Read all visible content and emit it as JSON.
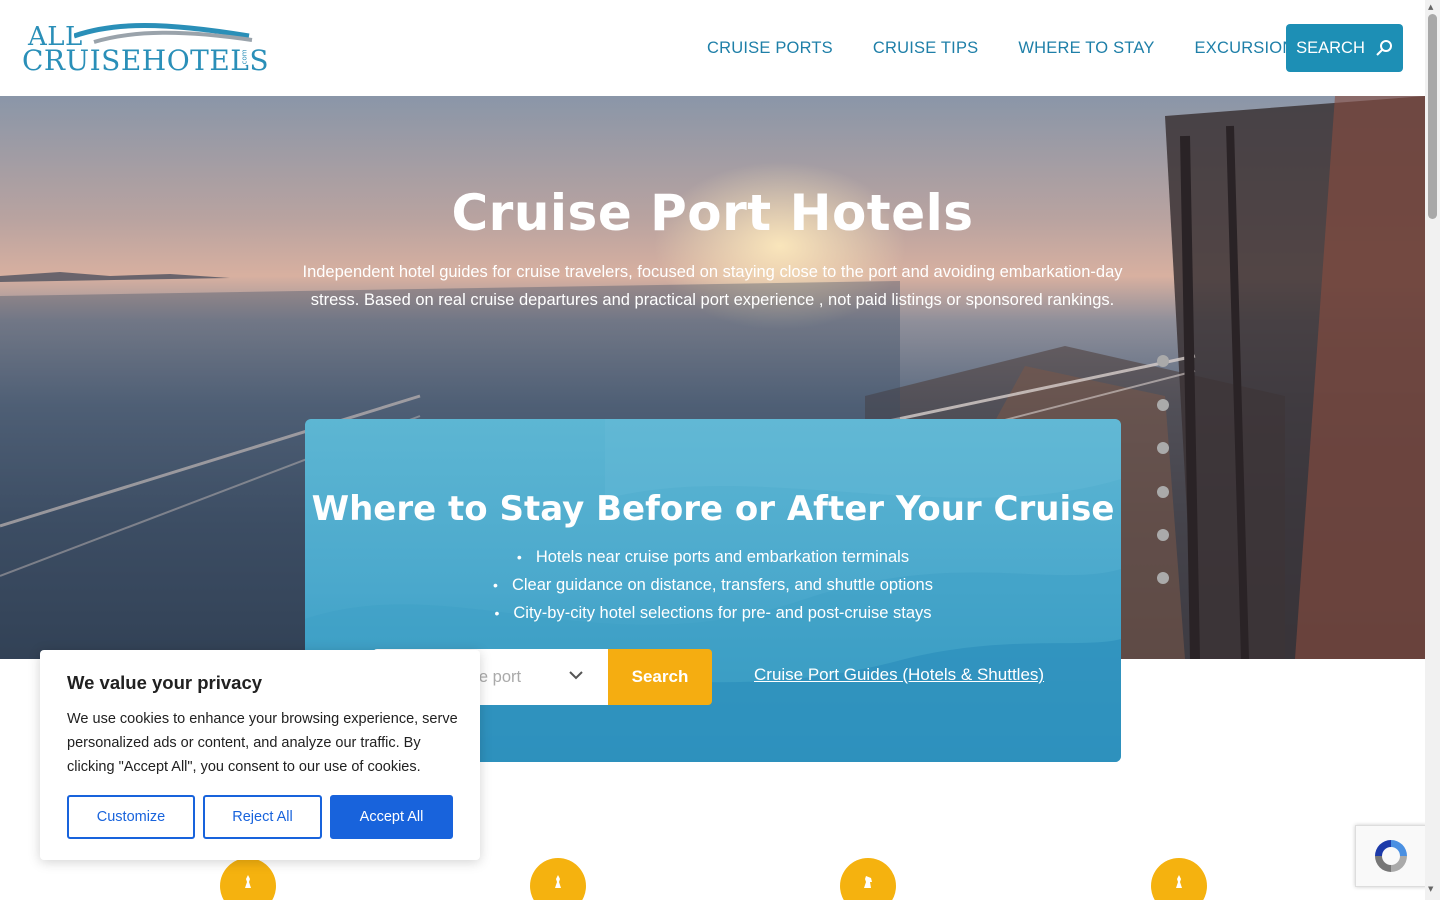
{
  "header": {
    "logo_line1": "ALL",
    "logo_line2": "CRUISEHOTELS",
    "logo_com": ".com",
    "nav": [
      {
        "label": "CRUISE PORTS"
      },
      {
        "label": "CRUISE TIPS"
      },
      {
        "label": "WHERE TO STAY"
      },
      {
        "label": "EXCURSIONS"
      }
    ],
    "search_label": "SEARCH"
  },
  "hero": {
    "title": "Cruise Port Hotels",
    "description": "Independent hotel guides for cruise travelers, focused on staying close to the port and avoiding embarkation-day stress. Based on real cruise departures and practical port experience , not paid listings or sponsored rankings."
  },
  "card": {
    "title": "Where to Stay Before or After Your Cruise",
    "bullets": [
      "Hotels near cruise ports and embarkation terminals",
      "Clear guidance on distance, transfers, and shuttle options",
      "City-by-city hotel selections for pre- and post-cruise stays"
    ],
    "select_placeholder": "ise port",
    "search_button": "Search",
    "guides_link": "Cruise Port Guides (Hotels & Shuttles)"
  },
  "cookie": {
    "title": "We value your privacy",
    "text": "We use cookies to enhance your browsing experience, serve personalized ads or content, and analyze our traffic. By clicking \"Accept All\", you consent to our use of cookies.",
    "customize": "Customize",
    "reject": "Reject All",
    "accept": "Accept All"
  },
  "colors": {
    "brand": "#1d8fb5",
    "accent": "#f5ad11",
    "cookie_button": "#1863dc"
  }
}
